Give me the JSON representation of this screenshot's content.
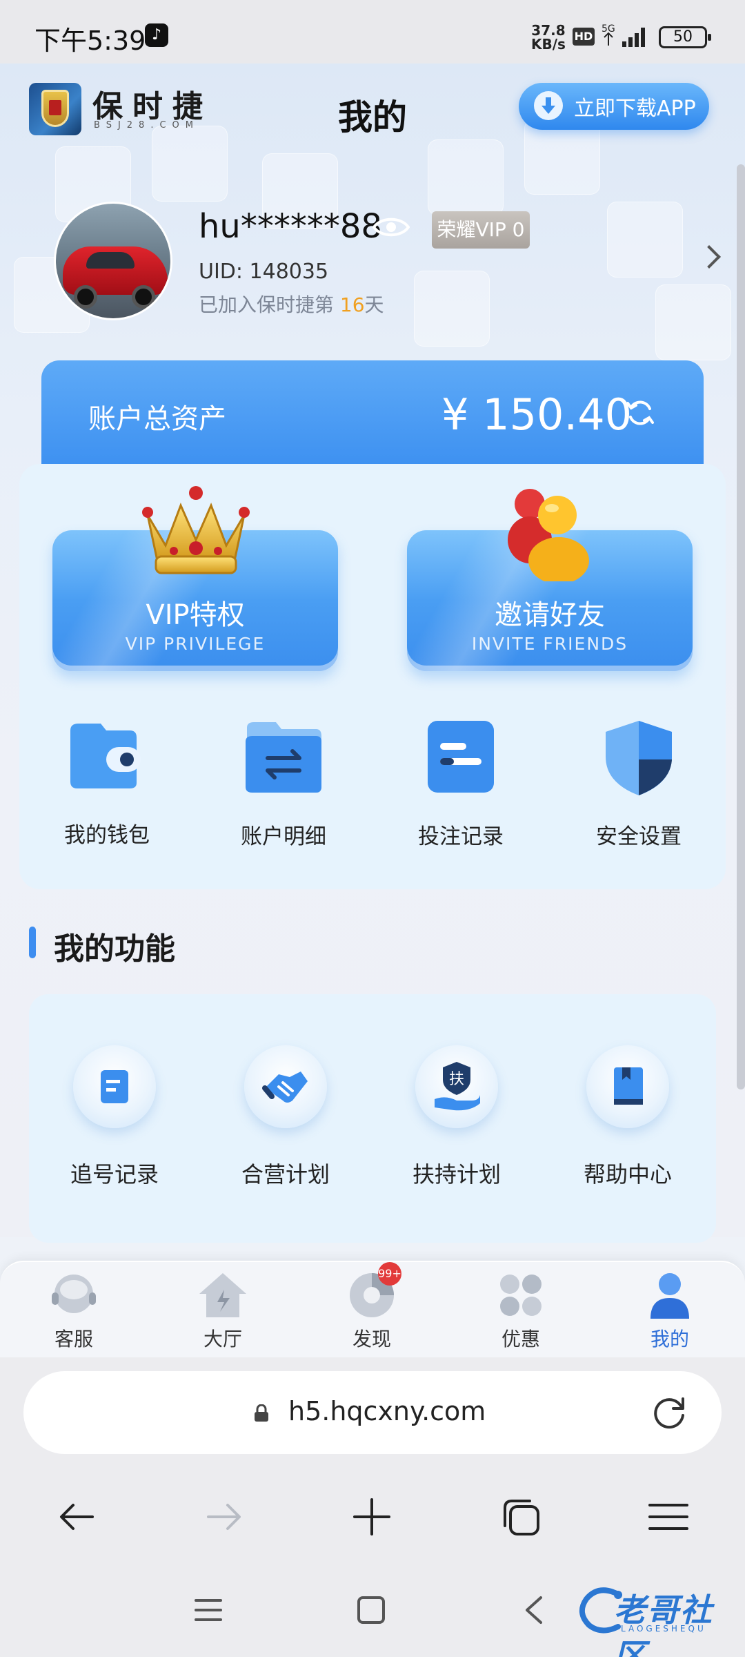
{
  "status_bar": {
    "time": "下午5:39",
    "net_speed_value": "37.8",
    "net_speed_unit": "KB/s",
    "hd": "HD",
    "network": "5G",
    "battery": "50"
  },
  "header": {
    "logo_name": "保时捷",
    "logo_domain": "BSJ28.COM",
    "title": "我的",
    "download_label": "立即下载APP"
  },
  "profile": {
    "username": "hu******88",
    "vip_badge": "荣耀VIP 0",
    "uid": "UID: 148035",
    "joined_prefix": "已加入保时捷第 ",
    "joined_days": "16",
    "joined_suffix": "天"
  },
  "assets": {
    "label": "账户总资产",
    "value": "¥ 150.40"
  },
  "promo_buttons": [
    {
      "title": "VIP特权",
      "subtitle": "VIP PRIVILEGE"
    },
    {
      "title": "邀请好友",
      "subtitle": "INVITE FRIENDS"
    }
  ],
  "quick_actions": [
    {
      "label": "我的钱包",
      "icon": "wallet-icon"
    },
    {
      "label": "账户明细",
      "icon": "folder-transfer-icon"
    },
    {
      "label": "投注记录",
      "icon": "record-icon"
    },
    {
      "label": "安全设置",
      "icon": "shield-icon"
    }
  ],
  "functions": {
    "title": "我的功能",
    "items": [
      {
        "label": "追号记录",
        "icon": "note-icon"
      },
      {
        "label": "合营计划",
        "icon": "handshake-icon"
      },
      {
        "label": "扶持计划",
        "icon": "support-hand-icon",
        "glyph": "扶"
      },
      {
        "label": "帮助中心",
        "icon": "book-icon"
      }
    ]
  },
  "tabbar": {
    "items": [
      {
        "label": "客服",
        "icon": "headset-icon",
        "active": false
      },
      {
        "label": "大厅",
        "icon": "home-icon",
        "active": false
      },
      {
        "label": "发现",
        "icon": "discover-icon",
        "active": false,
        "badge": "99+"
      },
      {
        "label": "优惠",
        "icon": "clover-icon",
        "active": false
      },
      {
        "label": "我的",
        "icon": "user-icon",
        "active": true
      }
    ]
  },
  "browser": {
    "url": "h5.hqcxny.com"
  },
  "watermark": {
    "text": "老哥社区",
    "sub": "LAOGESHEQU"
  },
  "colors": {
    "accent": "#3a8ef0",
    "active_tab": "#2f6fd8",
    "days_highlight": "#f0a020",
    "badge_red": "#e23a3a"
  }
}
